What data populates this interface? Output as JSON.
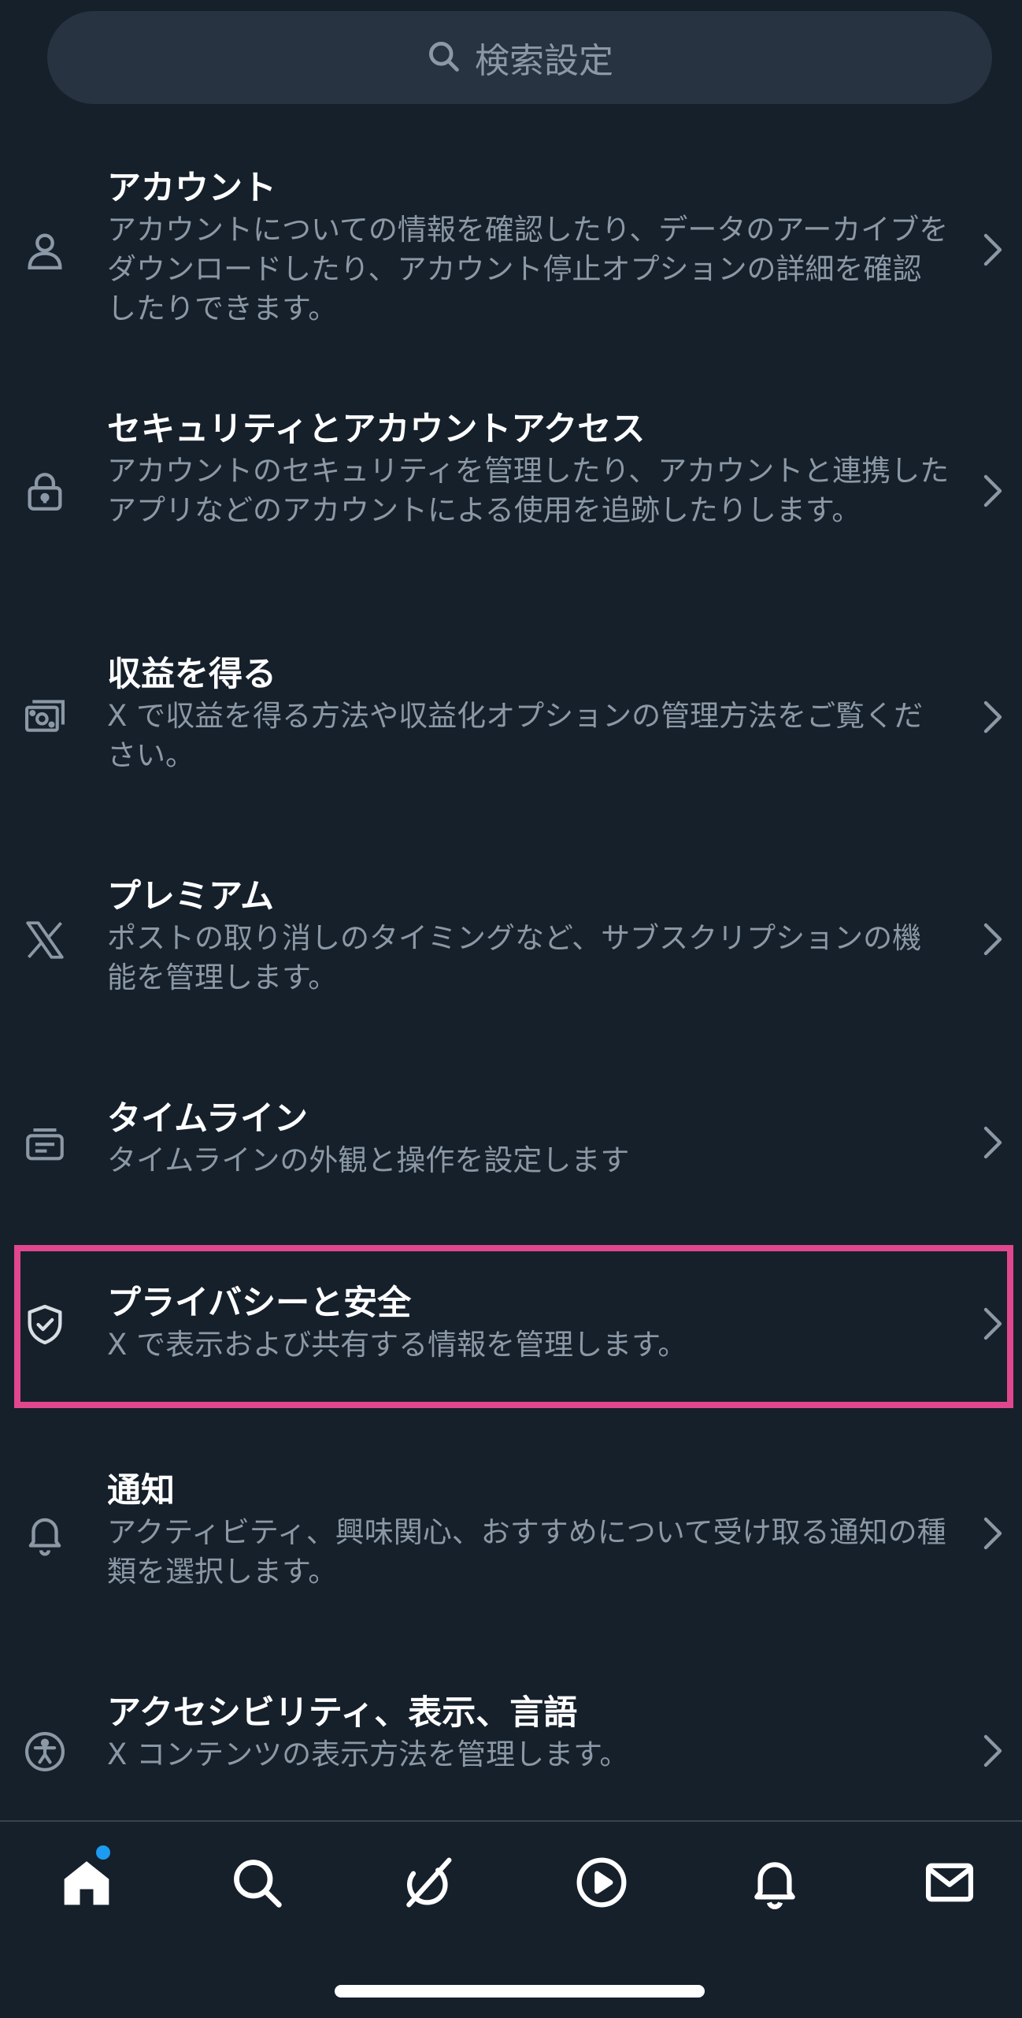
{
  "search": {
    "placeholder": "検索設定"
  },
  "settings": [
    {
      "icon": "person-icon",
      "title": "アカウント",
      "desc": "アカウントについての情報を確認したり、データのアーカイブをダウンロードしたり、アカウント停止オプションの詳細を確認したりできます。"
    },
    {
      "icon": "lock-icon",
      "title": "セキュリティとアカウントアクセス",
      "desc": "アカウントのセキュリティを管理したり、アカウントと連携したアプリなどのアカウントによる使用を追跡したりします。"
    },
    {
      "icon": "money-icon",
      "title": "収益を得る",
      "desc": "X で収益を得る方法や収益化オプションの管理方法をご覧ください。"
    },
    {
      "icon": "x-logo-icon",
      "title": "プレミアム",
      "desc": "ポストの取り消しのタイミングなど、サブスクリプションの機能を管理します。"
    },
    {
      "icon": "timeline-icon",
      "title": "タイムライン",
      "desc": "タイムラインの外観と操作を設定します"
    },
    {
      "icon": "shield-icon",
      "title": "プライバシーと安全",
      "desc": "X で表示および共有する情報を管理します。"
    },
    {
      "icon": "bell-icon",
      "title": "通知",
      "desc": "アクティビティ、興味関心、おすすめについて受け取る通知の種類を選択します。"
    },
    {
      "icon": "accessibility-icon",
      "title": "アクセシビリティ、表示、言語",
      "desc": "X コンテンツの表示方法を管理します。"
    }
  ],
  "highlight": {
    "color": "#e0478f"
  },
  "colors": {
    "background": "#15202b",
    "accent": "#1d9bf0",
    "muted": "#8b98a5"
  },
  "bottom_nav": [
    "home-icon",
    "search-icon",
    "grok-icon",
    "video-icon",
    "bell-icon",
    "mail-icon"
  ]
}
